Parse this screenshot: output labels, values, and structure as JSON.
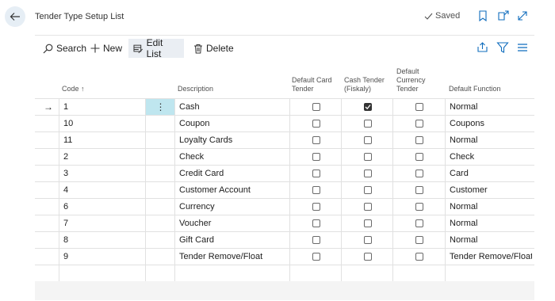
{
  "page": {
    "title": "Tender Type Setup List",
    "saved_label": "Saved"
  },
  "toolbar": {
    "search": "Search",
    "new": "New",
    "edit_list": "Edit List",
    "delete": "Delete"
  },
  "columns": {
    "code": "Code",
    "description": "Description",
    "default_card_tender": "Default Card Tender",
    "cash_tender": "Cash Tender (Fiskaly)",
    "default_currency_tender": "Default Currency Tender",
    "default_function": "Default Function"
  },
  "sort_indicator": "↑",
  "rows": [
    {
      "code": "1",
      "description": "Cash",
      "default_card_tender": false,
      "cash_tender": true,
      "default_currency_tender": false,
      "default_function": "Normal",
      "selected": true
    },
    {
      "code": "10",
      "description": "Coupon",
      "default_card_tender": false,
      "cash_tender": false,
      "default_currency_tender": false,
      "default_function": "Coupons"
    },
    {
      "code": "11",
      "description": "Loyalty Cards",
      "default_card_tender": false,
      "cash_tender": false,
      "default_currency_tender": false,
      "default_function": "Normal"
    },
    {
      "code": "2",
      "description": "Check",
      "default_card_tender": false,
      "cash_tender": false,
      "default_currency_tender": false,
      "default_function": "Check"
    },
    {
      "code": "3",
      "description": "Credit Card",
      "default_card_tender": false,
      "cash_tender": false,
      "default_currency_tender": false,
      "default_function": "Card"
    },
    {
      "code": "4",
      "description": "Customer Account",
      "default_card_tender": false,
      "cash_tender": false,
      "default_currency_tender": false,
      "default_function": "Customer"
    },
    {
      "code": "6",
      "description": "Currency",
      "default_card_tender": false,
      "cash_tender": false,
      "default_currency_tender": false,
      "default_function": "Normal"
    },
    {
      "code": "7",
      "description": "Voucher",
      "default_card_tender": false,
      "cash_tender": false,
      "default_currency_tender": false,
      "default_function": "Normal"
    },
    {
      "code": "8",
      "description": "Gift Card",
      "default_card_tender": false,
      "cash_tender": false,
      "default_currency_tender": false,
      "default_function": "Normal"
    },
    {
      "code": "9",
      "description": "Tender Remove/Float",
      "default_card_tender": false,
      "cash_tender": false,
      "default_currency_tender": false,
      "default_function": "Tender Remove/Float"
    }
  ],
  "colors": {
    "accent": "#0f6cbd",
    "selected_cell": "#bfe6ef",
    "grid_line": "#e1e1e1"
  }
}
